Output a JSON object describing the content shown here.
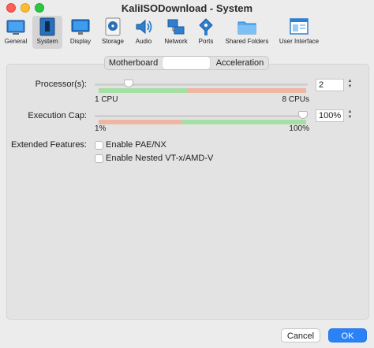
{
  "window": {
    "title": "KaliISODownload - System"
  },
  "toolbar": {
    "items": [
      {
        "label": "General",
        "icon": "general-icon"
      },
      {
        "label": "System",
        "icon": "system-icon"
      },
      {
        "label": "Display",
        "icon": "display-icon"
      },
      {
        "label": "Storage",
        "icon": "storage-icon"
      },
      {
        "label": "Audio",
        "icon": "audio-icon"
      },
      {
        "label": "Network",
        "icon": "network-icon"
      },
      {
        "label": "Ports",
        "icon": "ports-icon"
      },
      {
        "label": "Shared Folders",
        "icon": "shared-folders-icon"
      },
      {
        "label": "User Interface",
        "icon": "user-interface-icon"
      }
    ],
    "selected": "System"
  },
  "tabs": [
    {
      "label": "Motherboard"
    },
    {
      "label": ""
    },
    {
      "label": "Acceleration"
    }
  ],
  "processors": {
    "label": "Processor(s):",
    "value": "2",
    "min_label": "1 CPU",
    "max_label": "8 CPUs",
    "fraction": 0.143
  },
  "execution_cap": {
    "label": "Execution Cap:",
    "value": "100%",
    "min_label": "1%",
    "max_label": "100%",
    "fraction": 1.0
  },
  "extended_features": {
    "label": "Extended Features:",
    "options": [
      {
        "label": "Enable PAE/NX",
        "checked": false
      },
      {
        "label": "Enable Nested VT-x/AMD-V",
        "checked": false
      }
    ]
  },
  "buttons": {
    "cancel": "Cancel",
    "ok": "OK"
  },
  "colors": {
    "accent": "#2a82f6",
    "safe_zone": "#a6dfa3",
    "warn_zone": "#efb7a2"
  }
}
